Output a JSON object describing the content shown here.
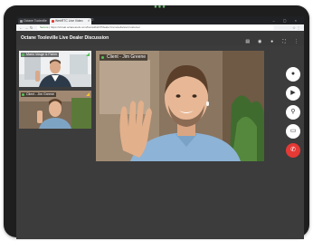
{
  "browser": {
    "tabs": [
      {
        "label": "Octane Tooleville",
        "active": false
      },
      {
        "label": "WebRTC Live Video",
        "active": true
      }
    ],
    "url_prefix": "Secure",
    "url": "https://virtual.octanetools.com/live/a1b2c3?dealer=remote&view=customer"
  },
  "app": {
    "title": "Octane Tooleville Live Dealer Discussion",
    "header_icons": [
      "chat-icon",
      "camera-icon",
      "microphone-icon",
      "fullscreen-icon",
      "more-icon"
    ]
  },
  "videos": {
    "main": {
      "label": "Client - Jim Greene"
    },
    "side": [
      {
        "label": "Mario Vosge & Fisher"
      },
      {
        "label": "Client - Jim Greene"
      }
    ]
  },
  "controls": [
    {
      "name": "microphone",
      "icon": "microphone-icon"
    },
    {
      "name": "video",
      "icon": "video-camera-icon"
    },
    {
      "name": "zoom",
      "icon": "zoom-icon"
    },
    {
      "name": "screen",
      "icon": "screen-share-icon"
    },
    {
      "name": "end-call",
      "icon": "phone-end-icon",
      "color": "#e53935"
    }
  ],
  "colors": {
    "accent_green": "#55c35a",
    "end_call": "#e53935"
  }
}
